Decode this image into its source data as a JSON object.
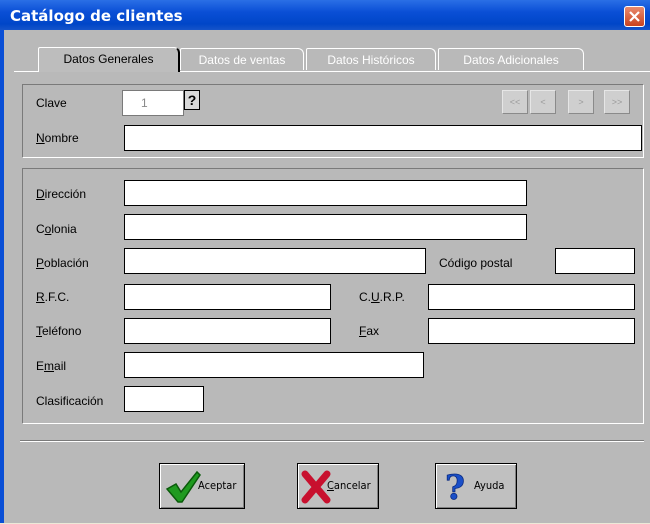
{
  "window": {
    "title": "Catálogo de clientes"
  },
  "tabs": [
    {
      "label": "Datos Generales"
    },
    {
      "label": "Datos de ventas"
    },
    {
      "label": "Datos Históricos"
    },
    {
      "label": "Datos Adicionales"
    }
  ],
  "form": {
    "clave": {
      "label": "Clave",
      "value": "1",
      "help": "?"
    },
    "nav": {
      "first": "<<",
      "prev": "<",
      "next": ">",
      "last": ">>"
    },
    "nombre": {
      "label_pre": "",
      "label_u": "N",
      "label_post": "ombre",
      "value": ""
    },
    "direccion": {
      "label_u": "D",
      "label_post": "irección",
      "value": ""
    },
    "colonia": {
      "label_pre": "C",
      "label_u": "o",
      "label_post": "lonia",
      "value": ""
    },
    "poblacion": {
      "label_u": "P",
      "label_post": "oblación",
      "value": ""
    },
    "codigo_postal": {
      "label_pre": "Códi",
      "label_u": "g",
      "label_post": "o postal",
      "value": ""
    },
    "rfc": {
      "label_u": "R",
      "label_post": ".F.C.",
      "value": ""
    },
    "curp": {
      "label_pre": "C.",
      "label_u": "U",
      "label_post": ".R.P.",
      "value": ""
    },
    "telefono": {
      "label_u": "T",
      "label_post": "eléfono",
      "value": ""
    },
    "fax": {
      "label_u": "F",
      "label_post": "ax",
      "value": ""
    },
    "email": {
      "label_pre": "E",
      "label_u": "m",
      "label_post": "ail",
      "value": ""
    },
    "clasificacion": {
      "label": "Clasificación",
      "value": ""
    }
  },
  "buttons": {
    "aceptar": "Aceptar",
    "cancelar_u": "C",
    "cancelar_post": "ancelar",
    "ayuda": "Ayuda"
  },
  "colors": {
    "titlebar": "#0a4fd6",
    "client_bg": "#b9b9b9",
    "close": "#c9431f"
  }
}
